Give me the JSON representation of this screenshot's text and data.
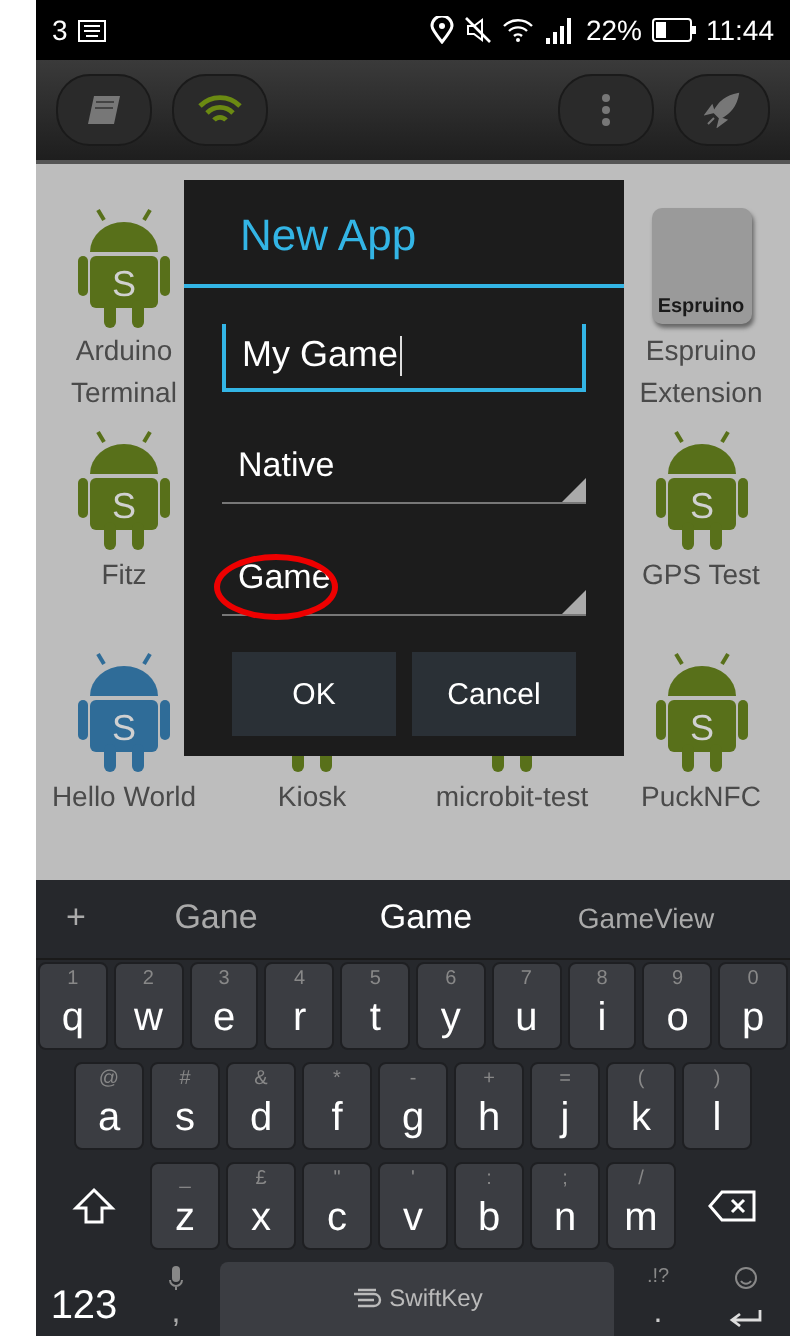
{
  "status_bar": {
    "left_text": "3",
    "battery_text": "22%",
    "time": "11:44"
  },
  "toolbar": {
    "buttons": [
      {
        "kind": "book"
      },
      {
        "kind": "wifi"
      },
      {
        "kind": "more"
      },
      {
        "kind": "rocket"
      }
    ]
  },
  "apps": [
    {
      "kind": "android",
      "color": "#58701a",
      "badge": "S",
      "label": "Arduino Terminal"
    },
    {
      "kind": "device",
      "device_text": "Espruino",
      "label": "Espruino Extension"
    },
    {
      "kind": "android",
      "color": "#58701a",
      "badge": "S",
      "label": "Fitz"
    },
    {
      "kind": "android",
      "color": "#58701a",
      "badge": "S",
      "label": "GPS Test"
    },
    {
      "kind": "android",
      "color": "#2f6c98",
      "badge": "S",
      "label": "Hello World"
    },
    {
      "kind": "android",
      "color": "#58701a",
      "label": "Kiosk"
    },
    {
      "kind": "android",
      "color": "#58701a",
      "label": "microbit-test"
    },
    {
      "kind": "android",
      "color": "#58701a",
      "badge": "S",
      "label": "PuckNFC"
    }
  ],
  "dialog": {
    "title": "New App",
    "name_field": {
      "value": "My Game"
    },
    "spinners": [
      {
        "value": "Native",
        "circled": false
      },
      {
        "value": "Game",
        "circled": true
      }
    ],
    "buttons": [
      "OK",
      "Cancel"
    ]
  },
  "keyboard": {
    "suggestions": [
      {
        "text": "+",
        "selected": false
      },
      {
        "text": "Gane",
        "selected": false
      },
      {
        "text": "Game",
        "selected": true
      },
      {
        "text": "GameView",
        "selected": false
      }
    ],
    "rows": [
      [
        {
          "hint": "1",
          "key": "q"
        },
        {
          "hint": "2",
          "key": "w"
        },
        {
          "hint": "3",
          "key": "e"
        },
        {
          "hint": "4",
          "key": "r"
        },
        {
          "hint": "5",
          "key": "t"
        },
        {
          "hint": "6",
          "key": "y"
        },
        {
          "hint": "7",
          "key": "u"
        },
        {
          "hint": "8",
          "key": "i"
        },
        {
          "hint": "9",
          "key": "o"
        },
        {
          "hint": "0",
          "key": "p"
        }
      ],
      [
        {
          "hint": "@",
          "key": "a"
        },
        {
          "hint": "#",
          "key": "s"
        },
        {
          "hint": "&",
          "key": "d"
        },
        {
          "hint": "*",
          "key": "f"
        },
        {
          "hint": "-",
          "key": "g"
        },
        {
          "hint": "+",
          "key": "h"
        },
        {
          "hint": "=",
          "key": "j"
        },
        {
          "hint": "(",
          "key": "k"
        },
        {
          "hint": ")",
          "key": "l"
        }
      ],
      [
        {
          "hint": "_",
          "key": "z"
        },
        {
          "hint": "£",
          "key": "x"
        },
        {
          "hint": "\"",
          "key": "c"
        },
        {
          "hint": "'",
          "key": "v"
        },
        {
          "hint": ":",
          "key": "b"
        },
        {
          "hint": ";",
          "key": "n"
        },
        {
          "hint": "/",
          "key": "m"
        }
      ]
    ],
    "numbers_key": "123",
    "comma_key": ",",
    "space_brand": "SwiftKey",
    "period_hint": ".!?",
    "period_key": "."
  }
}
